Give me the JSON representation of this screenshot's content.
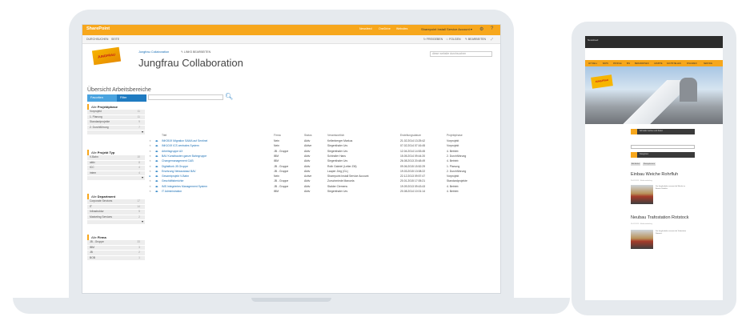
{
  "laptop": {
    "topbar": {
      "brand": "SharePoint",
      "links": [
        "Newsfeed",
        "OneDrive",
        "Websites"
      ],
      "user": "Sharepoint Install Service Account ▾",
      "gear_icon": "gear-icon",
      "help_icon": "help-icon"
    },
    "ribbon": {
      "left": [
        "DURCHSUCHEN",
        "SEITE"
      ],
      "right": [
        "↻ FREIGEBEN",
        "☆ FOLGEN",
        "✎ BEARBEITEN",
        "⤢"
      ]
    },
    "search_placeholder": "diese website durchsuchen",
    "logo_text": "JUNGFRAU",
    "breadcrumb": "Jungfrau Collaboration",
    "edit_links": "✎ LINKS BEARBEITEN",
    "page_title": "Jungfrau Collaboration",
    "overview_heading": "Übersicht Arbeitsbereiche",
    "tabs": [
      "Favoriten",
      "Filter"
    ],
    "refiners": [
      {
        "prefix": "Alle",
        "title": "Projektphase",
        "items": [
          {
            "label": "Vorprojekt",
            "count": "11"
          },
          {
            "label": "1. Planung",
            "count": "11"
          },
          {
            "label": "Standardprojekte",
            "count": "9"
          },
          {
            "label": "2. Durchführung",
            "count": "7"
          }
        ]
      },
      {
        "prefix": "Alle",
        "title": "Projekt Typ",
        "items": [
          {
            "label": "V-Bahn",
            "count": "10"
          },
          {
            "label": "aktiv",
            "count": "8"
          },
          {
            "label": "ICC",
            "count": "4"
          },
          {
            "label": "intern",
            "count": "4"
          }
        ]
      },
      {
        "prefix": "Alle",
        "title": "Department",
        "items": [
          {
            "label": "Corporate Services",
            "count": "17"
          },
          {
            "label": "IT",
            "count": "14"
          },
          {
            "label": "Infrastruktur",
            "count": "5"
          },
          {
            "label": "Marketing Services",
            "count": "2"
          }
        ]
      },
      {
        "prefix": "Alle",
        "title": "Firma",
        "items": [
          {
            "label": "JB - Gruppe",
            "count": "33"
          },
          {
            "label": "IBM",
            "count": "3"
          },
          {
            "label": "JB",
            "count": "2"
          },
          {
            "label": "BOB",
            "count": "1"
          }
        ]
      }
    ],
    "table": {
      "headers": [
        "Titel",
        "Firma",
        "Status",
        "Verantwortlich",
        "Erstellungsdatum",
        "Projektphase"
      ],
      "rows": [
        [
          "INK0519 Migration SAMA auf Sentinel",
          "Nein",
          "Aktiv",
          "Kellenberger Markus",
          "21.02.2014 13:25:42",
          "Vorprojekt"
        ],
        [
          "INK1019 ICS zentrales System",
          "Nein",
          "Aktive",
          "Siegenthaler Urs",
          "07.02.2014 07:16:45",
          "Vorprojekt"
        ],
        [
          "Arbeitsgruppe AX",
          "JB - Gruppe",
          "Aktiv",
          "Siegenthaler Urs",
          "12.04.2014 14:53:45",
          "4. Betrieb"
        ],
        [
          "BAV Kunstbauten ganze Bahngruppe",
          "IBM",
          "Aktiv",
          "Schindler Hans",
          "15.05.2014 09:44:20",
          "2. Durchführung"
        ],
        [
          "Changemanagement CAB",
          "IBM",
          "Aktiv",
          "Siegenthaler Urs",
          "26.08.2013 20:48:49",
          "4. Betrieb"
        ],
        [
          "Digitalfunk JB Gruppe",
          "JB - Gruppe",
          "Aktiv",
          "Roth Gabriel (Leiter ZM)",
          "09.06.2015 15:52:29",
          "1. Planung"
        ],
        [
          "Ersetzung Netzausbaul BAV",
          "JB - Gruppe",
          "Aktiv",
          "Lauper Jörg (GL)",
          "19.03.2015 13:08:22",
          "2. Durchführung"
        ],
        [
          "Gesamtprojekt V-Bahn",
          "Nein",
          "Active",
          "Sharepoint Install Service Account",
          "22.12.2013 09:57:47",
          "Vorprojekt"
        ],
        [
          "Geschäftsberichte",
          "JB - Gruppe",
          "Aktiv",
          "Zurschmiede Manuela",
          "20.01.2015 17:05:21",
          "Standardprojekte"
        ],
        [
          "IMS Integriertes Management System",
          "JB - Gruppe",
          "Aktiv",
          "Stalder Clemens",
          "19.09.2013 09:43:43",
          "4. Betrieb"
        ],
        [
          "IT Administration",
          "IBM",
          "Aktiv",
          "Siegenthaler Urs",
          "20.08.2014 10:01:14",
          "4. Betrieb"
        ]
      ],
      "selected_row": 7
    }
  },
  "tablet": {
    "topbar_label": "Newsfeed",
    "nav": [
      "AKTUELL",
      "BAHN",
      "PROFILE",
      "BIS",
      "BERGBAHNEN",
      "GRUPPE",
      "FACHSTELLEN",
      "FINANZEN",
      "SERVICE"
    ],
    "logo_text": "JUNGFRAU",
    "box1": "Schneller suchen und finden",
    "box2": "Kategorien",
    "buttons": [
      "Alle Artikel",
      "Meistgelesene"
    ],
    "articles": [
      {
        "title": "Einbau Weiche Rohrfluh",
        "meta": "20.01.2015 · Medienmitteilung",
        "snippet": "Die Jungfraubahn erneuert die Weiche im Bereich Rohrfluh."
      },
      {
        "title": "Neubau Trafostation Rotstock",
        "meta": "14.01.2015 · Medienmitteilung",
        "snippet": "Die Jungfraubahn erneuert die Trafostation Rotstock."
      }
    ]
  },
  "colors": {
    "accent": "#f7a71c",
    "link": "#1a6fb5",
    "tab": "#4aa3df",
    "logo_red": "#c0121a"
  }
}
